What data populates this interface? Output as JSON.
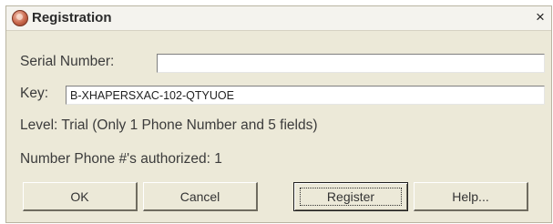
{
  "dialog": {
    "title": "Registration",
    "close_symbol": "×",
    "icons": {
      "app": "registration-app-icon",
      "close": "close-icon"
    }
  },
  "form": {
    "serial_label": "Serial Number:",
    "serial_value": "",
    "key_label": "Key:",
    "key_value": "B-XHAPERSXAC-102-QTYUOE",
    "level_text": "Level: Trial (Only 1 Phone Number and 5 fields)",
    "authorized_text": "Number Phone #'s authorized:  1"
  },
  "buttons": {
    "ok": "OK",
    "cancel": "Cancel",
    "register": "Register",
    "help": "Help..."
  }
}
